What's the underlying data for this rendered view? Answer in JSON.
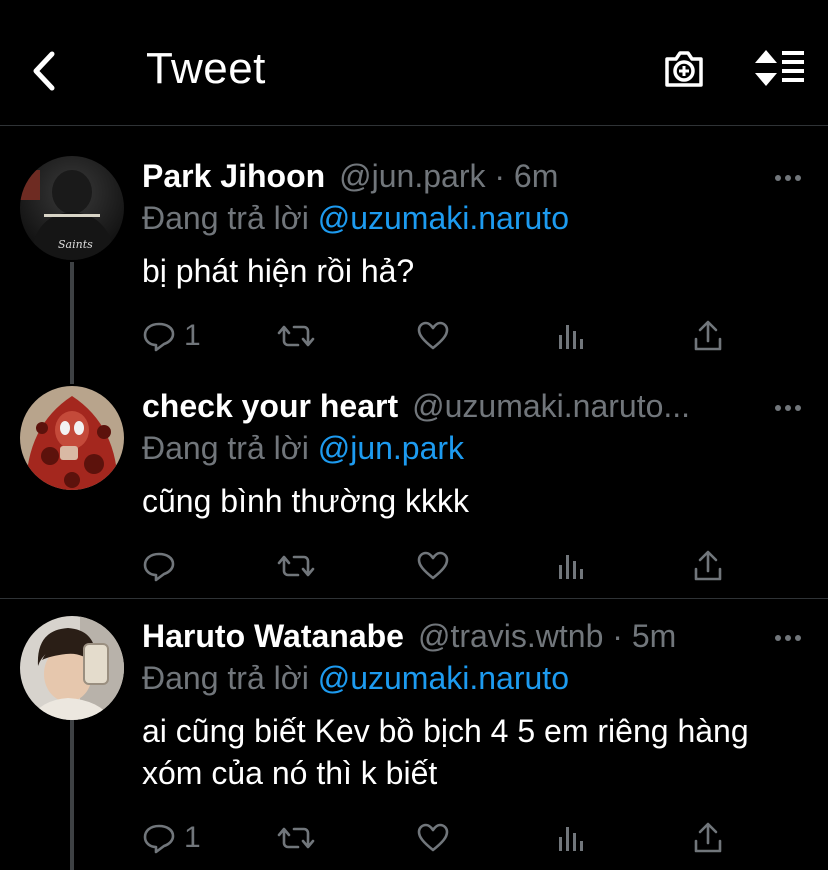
{
  "header": {
    "title": "Tweet",
    "back_icon": "chevron-left-icon",
    "camera_icon": "camera-add-icon",
    "sort_icon": "sort-list-icon"
  },
  "tweets": [
    {
      "name": "Park Jihoon",
      "handle": "@jun.park · 6m",
      "reply_prefix": "Đang trả lời",
      "reply_to": "@uzumaki.naruto",
      "text": "bị phát hiện rồi hả?",
      "reply_count": "1"
    },
    {
      "name": "check your heart",
      "handle": "@uzumaki.naruto...",
      "reply_prefix": "Đang trả lời",
      "reply_to": "@jun.park",
      "text": "cũng bình thường kkkk",
      "reply_count": ""
    },
    {
      "name": "Haruto Watanabe",
      "handle": "@travis.wtnb · 5m",
      "reply_prefix": "Đang trả lời",
      "reply_to": "@uzumaki.naruto",
      "text": "ai cũng biết Kev bồ bịch 4 5 em riêng hàng xóm của nó thì k biết",
      "reply_count": "1"
    }
  ],
  "colors": {
    "background": "#000000",
    "text": "#ffffff",
    "muted": "#71767b",
    "link": "#1d9bf0",
    "divider": "#2f3336"
  }
}
